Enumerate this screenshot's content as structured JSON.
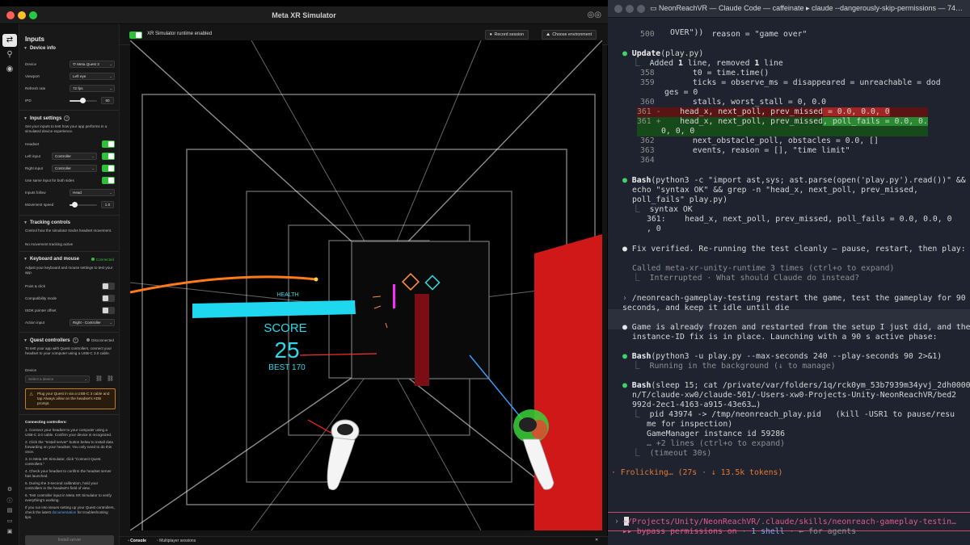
{
  "xr": {
    "title": "Meta XR Simulator",
    "runtime_label": "XR Simulator runtime enabled",
    "record_label": "Record session",
    "env_label": "Choose environment",
    "bottom_tabs": [
      "Console",
      "Multiplayer sessions"
    ],
    "panel": {
      "title": "Inputs",
      "device_info": {
        "heading": "Device info",
        "device_label": "Device",
        "device_value": "Meta Quest 3",
        "viewport_label": "Viewport",
        "viewport_value": "Left eye",
        "refresh_label": "Refresh rate",
        "refresh_value": "72 fps",
        "ipd_label": "IPD",
        "ipd_value": "60"
      },
      "input_settings": {
        "heading": "Input settings",
        "desc": "Set your inputs to test how your app performs in a simulated device experience.",
        "headset_label": "Headset",
        "left_input_label": "Left input",
        "left_input_value": "Controller",
        "right_input_label": "Right input",
        "right_input_value": "Controller",
        "same_input_label": "Use same input for both sides",
        "inputs_follow_label": "Inputs follow",
        "inputs_follow_value": "Head",
        "movement_speed_label": "Movement speed",
        "movement_speed_value": "1.0"
      },
      "tracking": {
        "heading": "Tracking controls",
        "desc": "Control how the simulator tracks headset movement.",
        "status": "No movement tracking active"
      },
      "keyboard": {
        "heading": "Keyboard and mouse",
        "status": "Connected",
        "desc": "Adjust your keyboard and mouse settings to test your app.",
        "point_click_label": "Point & click",
        "compat_label": "Compatibility mode",
        "isdk_label": "ISDK pointer offset",
        "action_input_label": "Action input",
        "action_input_value": "Right - Controller"
      },
      "quest": {
        "heading": "Quest controllers",
        "status": "Disconnected",
        "desc": "To test your app with Quest controllers, connect your headset to your computer using a USB-C 3.0 cable.",
        "device_label": "Device",
        "device_placeholder": "Select a device",
        "warning": "Plug your Quest in via a USB-C 3 cable and tap Always allow on the headset's ADB prompt.",
        "connecting_heading": "Connecting controllers:",
        "steps": [
          "1. Connect your headset to your computer using a USB-C 3.0 cable. Confirm your device is recognized.",
          "2. Click the \"Install server\" button below to install data forwarding on your headset. You only need to do this once.",
          "3. In Meta XR Simulator, click \"Connect Quest controllers.\"",
          "4. Check your headset to confirm the headset server has launched.",
          "5. During the 3-second calibration, hold your controllers in the headset's field of view.",
          "6. Test controller input in Meta XR Simulator to verify everything's working."
        ],
        "help_prefix": "If you run into issues setting up your Quest controllers, check the latest ",
        "help_link": "documentation",
        "help_suffix": " for troubleshooting tips.",
        "install_label": "Install server"
      }
    },
    "scene": {
      "health_label": "HEALTH",
      "score_label": "SCORE",
      "score_value": "25",
      "best_label": "BEST 170",
      "health_fraction": 1.0
    }
  },
  "terminal": {
    "tab_title": "NeonReachVR — Claude Code — caffeinate ▸ claude --dangerously-skip-permissions — 74…",
    "lines": {
      "l1": "          OVER\"))",
      "l2_ln": "500",
      "l2_code": "            reason = \"game over\"",
      "upd_tool": "Update",
      "upd_arg": "(play.py)",
      "upd_sum_a": "Added ",
      "upd_sum_b": "1",
      "upd_sum_c": " line, removed ",
      "upd_sum_d": "1",
      "upd_sum_e": " line",
      "d358": "358",
      "c358": "        t0 = time.time()",
      "d359": "359",
      "c359": "        ticks = observe_ms = disappeared = unreachable = dod",
      "c359b": "ges = 0",
      "d360": "360",
      "c360": "        stalls, worst_stall = 0, 0.0",
      "d361a": "361 -",
      "c361a_pre": "    head_x, next_poll, prev_missed",
      "c361a_hl": " = 0.0, 0.0, 0",
      "d361b": "361 +",
      "c361b_pre": "    head_x, next_poll, prev_missed",
      "c361b_hl": ", poll_fails = 0.0, 0.",
      "c361b2": "0, 0, 0",
      "d362": "362",
      "c362": "        next_obstacle_poll, obstacles = 0.0, []",
      "d363": "363",
      "c363": "        events, reason = [], \"time limit\"",
      "d364": "364",
      "bash1_a": "Bash",
      "bash1_b": "(python3 -c \"import ast,sys; ast.parse(open('play.py').read())\" &&",
      "bash1_c": "echo \"syntax OK\" && grep -n \"head_x, next_poll, prev_missed,",
      "bash1_d": "poll_fails\" play.py)",
      "out1": "syntax OK",
      "out2": "361:    head_x, next_poll, prev_missed, poll_fails = 0.0, 0.0, 0",
      "out3": ", 0",
      "fix": "Fix verified. Re-running the test cleanly — pause, restart, then play:",
      "called": "Called meta-xr-unity-runtime 3 times (ctrl+o to expand)",
      "interrupted": "Interrupted · What should Claude do instead?",
      "user1": "/neonreach-gameplay-testing restart the game, test the gameplay for 90",
      "user2": "seconds, and keep it idle until die",
      "game1": "Game is already frozen and restarted from the setup I just did, and the",
      "game2": "instance-ID fix is in place. Launching with a 90 s active phase:",
      "bash2_a": "Bash",
      "bash2_b": "(python3 -u play.py --max-seconds 240 --play-seconds 90 2>&1)",
      "bash2_out": "Running in the background (↓ to manage)",
      "bash3_a": "Bash",
      "bash3_b": "(sleep 15; cat /private/var/folders/1q/rck0ym_53b7939m34yvj_2dh0000g",
      "bash3_c": "n/T/claude-xw0/claude-501/-Users-xw0-Projects-Unity-NeonReachVR/bed2",
      "bash3_d": "992d-2ec1-4163-a915-43e63…)",
      "pid1": "pid 43974 -> /tmp/neonreach_play.pid   (kill -USR1 to pause/resu",
      "pid2": "me for inspection)",
      "gm": "GameManager instance id 59286",
      "more": "… +2 lines (ctrl+o to expand)",
      "timeout": "(timeout 30s)",
      "frolic": "· Frolicking… (27s · ↓ 13.5k tokens)",
      "prompt": "›",
      "path": "~/Projects/Unity/NeonReachVR/.claude/skills/neonreach-gameplay-testin…",
      "bypass_a": "▸▸ ",
      "bypass_b": "bypass permissions on",
      "bypass_c": " · ",
      "bypass_d": "1 shell",
      "bypass_e": " · ← for agents"
    }
  },
  "colors": {
    "green": "#3fd46a",
    "toggle_on": "#2fbf3b",
    "cyan": "#1fd8f0",
    "red": "#e01c1c"
  }
}
